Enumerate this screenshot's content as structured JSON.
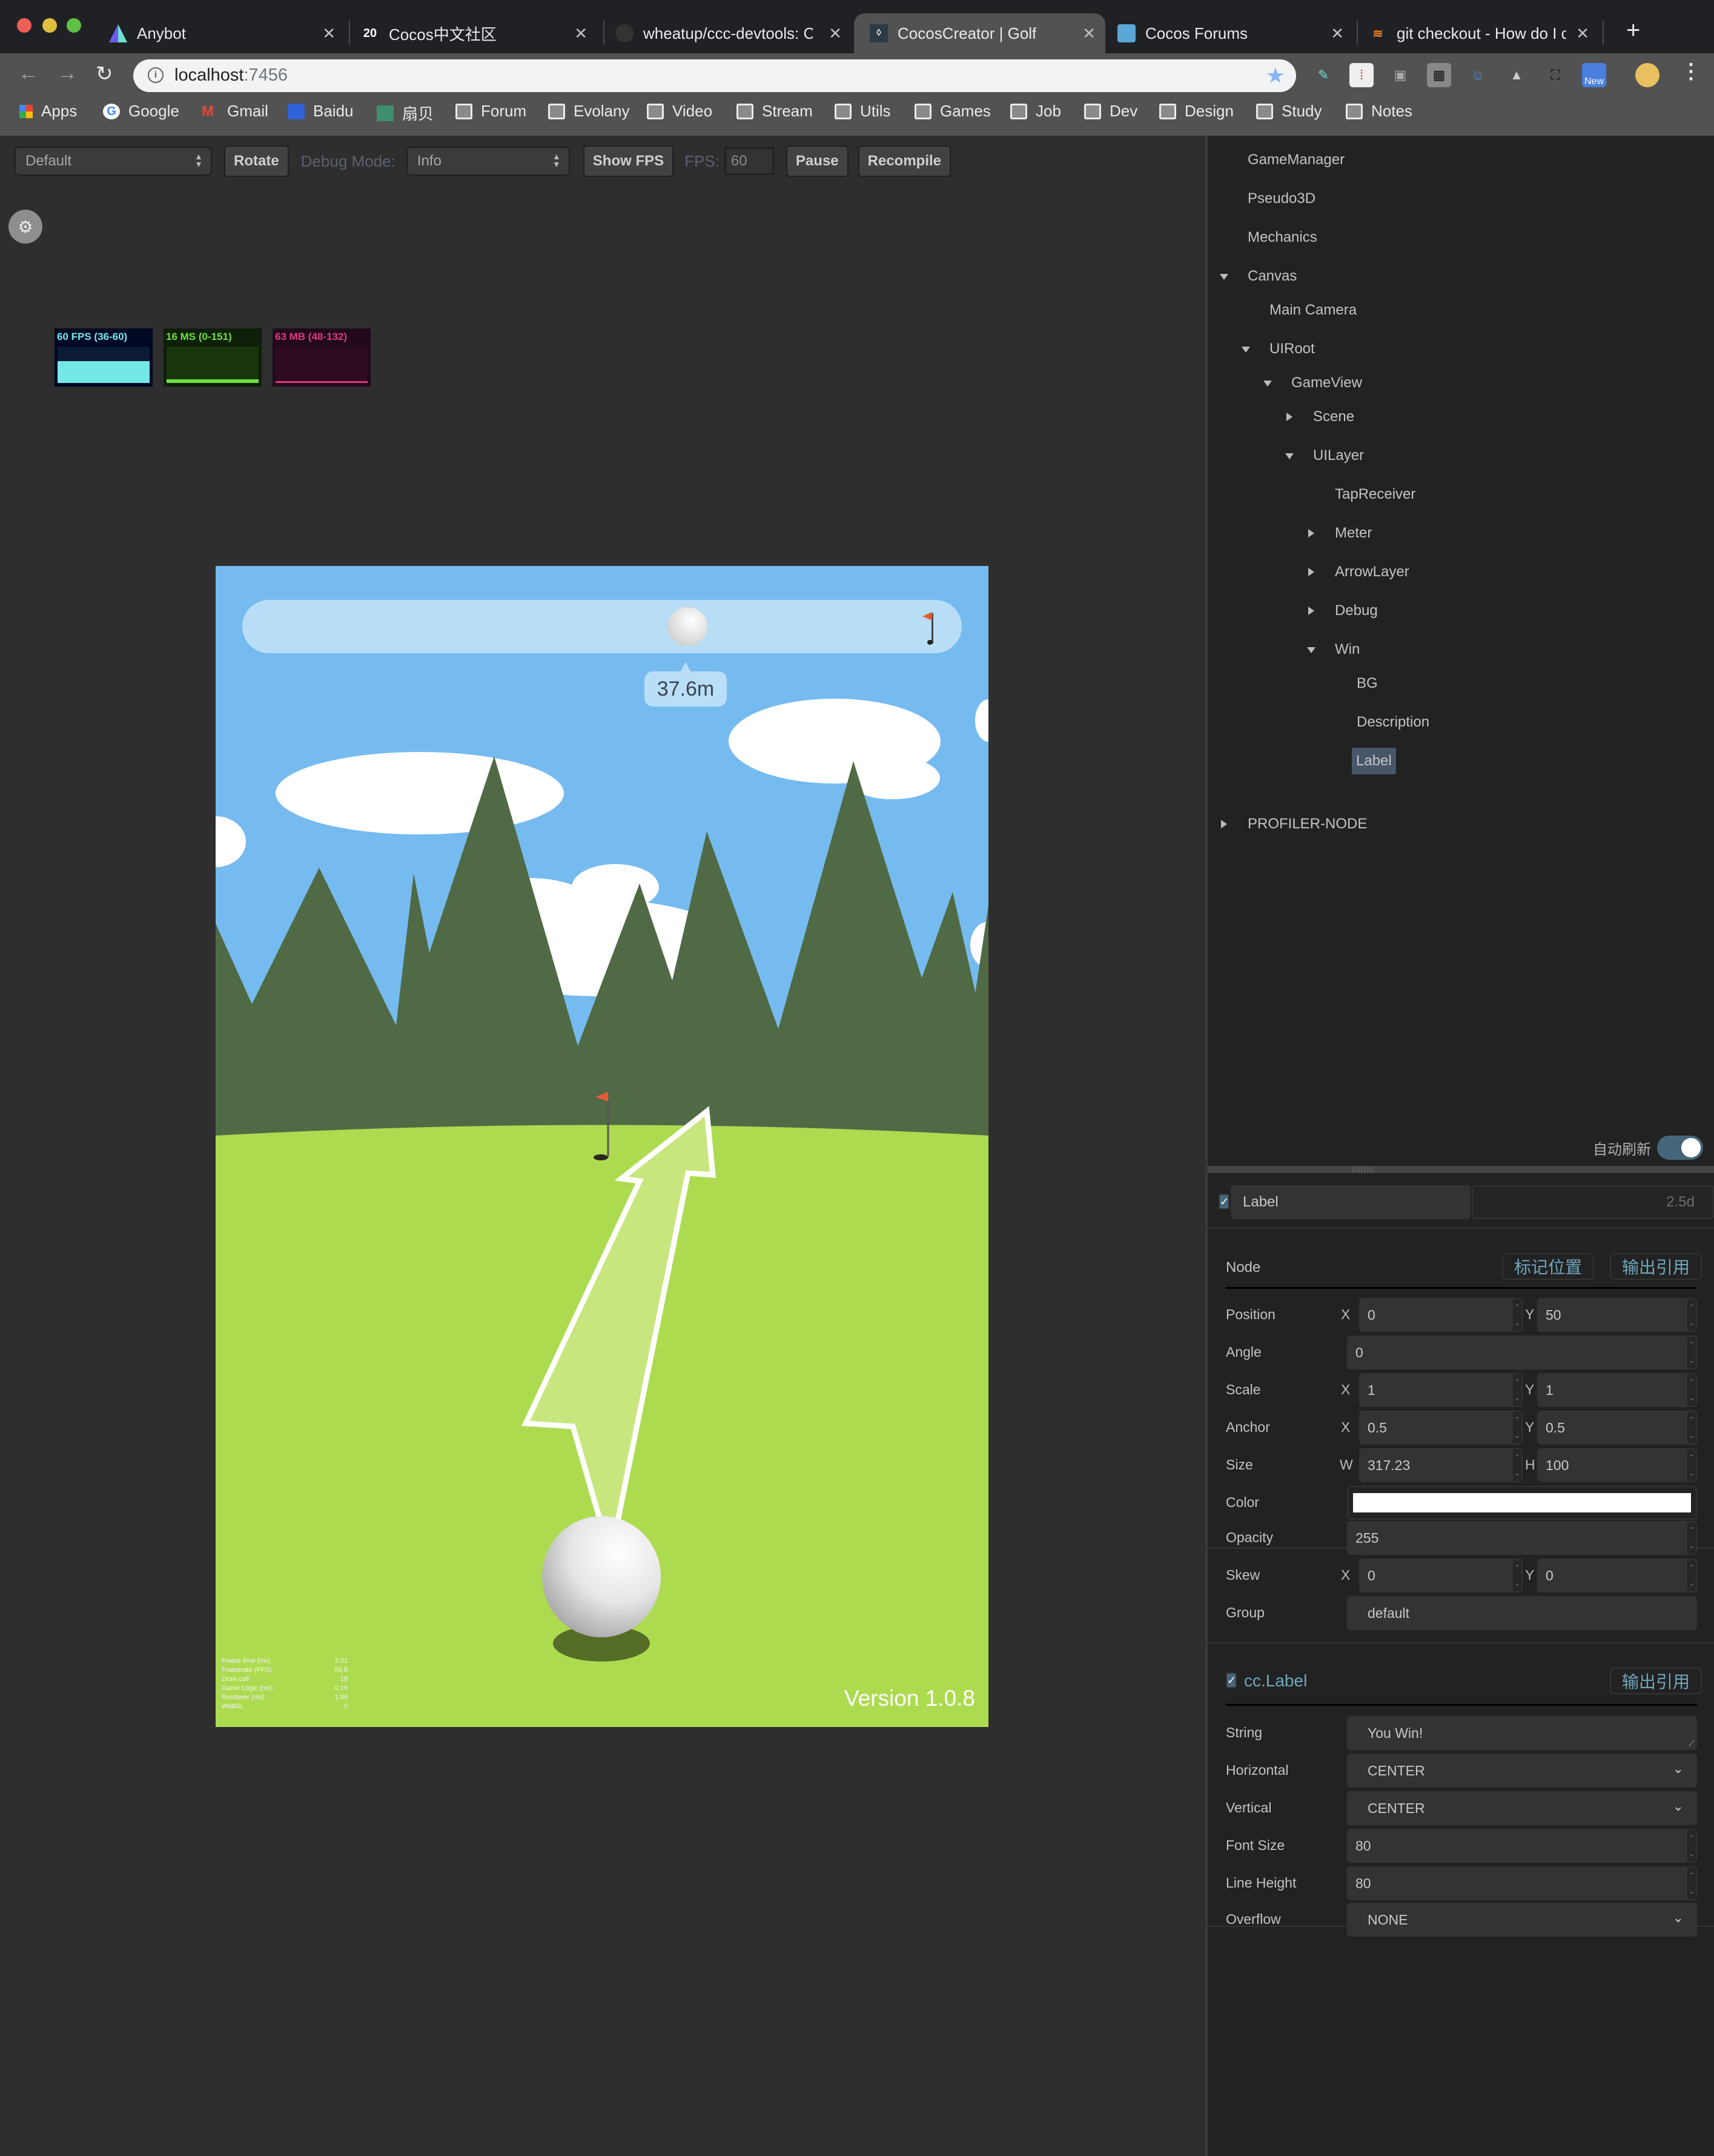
{
  "browser": {
    "tabs": [
      {
        "title": "Anybot",
        "icon": "anybot-icon",
        "active": false
      },
      {
        "title": "Cocos中文社区",
        "icon": "discourse-20-icon",
        "active": false
      },
      {
        "title": "wheatup/ccc-devtools: C",
        "icon": "github-icon",
        "active": false
      },
      {
        "title": "CocosCreator | Golf",
        "icon": "cocoscreator-icon",
        "active": true
      },
      {
        "title": "Cocos Forums",
        "icon": "cocos-icon",
        "active": false
      },
      {
        "title": "git checkout - How do I c",
        "icon": "stackoverflow-icon",
        "active": false
      }
    ],
    "new_tab": "+",
    "url_host": "localhost",
    "url_port": ":7456",
    "extensions": [
      "eyedropper-icon",
      "dice-icon",
      "tv-icon",
      "qr-code-icon",
      "avatar-glasses-icon",
      "drive-icon",
      "fullscreen-icon",
      "new-badge-icon"
    ],
    "new_badge": "New",
    "bookmarks": [
      {
        "label": "Apps",
        "icon": "apps-grid-icon"
      },
      {
        "label": "Google",
        "icon": "google-icon"
      },
      {
        "label": "Gmail",
        "icon": "gmail-icon"
      },
      {
        "label": "Baidu",
        "icon": "baidu-icon"
      },
      {
        "label": "扇贝",
        "icon": "shanbay-icon"
      },
      {
        "label": "Forum",
        "icon": "folder-icon"
      },
      {
        "label": "Evolany",
        "icon": "folder-icon"
      },
      {
        "label": "Video",
        "icon": "folder-icon"
      },
      {
        "label": "Stream",
        "icon": "folder-icon"
      },
      {
        "label": "Utils",
        "icon": "folder-icon"
      },
      {
        "label": "Games",
        "icon": "folder-icon"
      },
      {
        "label": "Job",
        "icon": "folder-icon"
      },
      {
        "label": "Dev",
        "icon": "folder-icon"
      },
      {
        "label": "Design",
        "icon": "folder-icon"
      },
      {
        "label": "Study",
        "icon": "folder-icon"
      },
      {
        "label": "Notes",
        "icon": "folder-icon"
      }
    ]
  },
  "preview_toolbar": {
    "device_select": "Default",
    "rotate": "Rotate",
    "debug_mode_label": "Debug Mode:",
    "debug_mode_value": "Info",
    "show_fps": "Show FPS",
    "fps_label": "FPS:",
    "fps_value": "60",
    "pause": "Pause",
    "recompile": "Recompile"
  },
  "profiler": [
    {
      "label": "60 FPS (36-60)",
      "color": "#74e8e8",
      "bg": "#000824",
      "graph_bg": "#0b1b35",
      "level": 0.6
    },
    {
      "label": "16 MS (0-151)",
      "color": "#6fe03f",
      "bg": "#0e1f0a",
      "graph_bg": "#18360e",
      "level": 0.1
    },
    {
      "label": "63 MB (48-132)",
      "color": "#de3a7d",
      "bg": "#21091a",
      "graph_bg": "#2e0b1f",
      "level": 0.05
    }
  ],
  "game": {
    "distance": "37.6m",
    "version": "Version 1.0.8",
    "debug_stats": [
      {
        "key": "Frame time (ms)",
        "value": "2.01"
      },
      {
        "key": "Framerate (FPS)",
        "value": "59.8"
      },
      {
        "key": "Draw call",
        "value": "18"
      },
      {
        "key": "Game Logic (ms)",
        "value": "0.16"
      },
      {
        "key": "Renderer (ms)",
        "value": "1.86"
      },
      {
        "key": "WebGL",
        "value": "0"
      }
    ],
    "colors": {
      "sky": "#76bbf0",
      "trees": "#506a45",
      "grass": "#addb50",
      "flag": "#e85a35"
    }
  },
  "devtools": {
    "tree": [
      {
        "label": "GameManager",
        "depth": 0,
        "toggle": "none"
      },
      {
        "label": "Pseudo3D",
        "depth": 0,
        "toggle": "none"
      },
      {
        "label": "Mechanics",
        "depth": 0,
        "toggle": "none"
      },
      {
        "label": "Canvas",
        "depth": 0,
        "toggle": "expanded"
      },
      {
        "label": "Main Camera",
        "depth": 1,
        "toggle": "none"
      },
      {
        "label": "UIRoot",
        "depth": 1,
        "toggle": "expanded"
      },
      {
        "label": "GameView",
        "depth": 2,
        "toggle": "expanded"
      },
      {
        "label": "Scene",
        "depth": 3,
        "toggle": "collapsed"
      },
      {
        "label": "UILayer",
        "depth": 3,
        "toggle": "expanded"
      },
      {
        "label": "TapReceiver",
        "depth": 4,
        "toggle": "none"
      },
      {
        "label": "Meter",
        "depth": 4,
        "toggle": "collapsed"
      },
      {
        "label": "ArrowLayer",
        "depth": 4,
        "toggle": "collapsed"
      },
      {
        "label": "Debug",
        "depth": 4,
        "toggle": "collapsed"
      },
      {
        "label": "Win",
        "depth": 4,
        "toggle": "expanded"
      },
      {
        "label": "BG",
        "depth": 5,
        "toggle": "none"
      },
      {
        "label": "Description",
        "depth": 5,
        "toggle": "none"
      },
      {
        "label": "Label",
        "depth": 5,
        "toggle": "none",
        "selected": true
      },
      {
        "label": "PROFILER-NODE",
        "depth": 0,
        "toggle": "collapsed"
      }
    ],
    "auto_refresh_label": "自动刷新",
    "auto_refresh_on": true,
    "node_name": "Label",
    "node_tag": "2.5d",
    "node_active": true,
    "node_section": {
      "title": "Node",
      "mark_position": "标记位置",
      "export_ref": "输出引用",
      "position": {
        "label": "Position",
        "x": "0",
        "y": "50"
      },
      "angle": {
        "label": "Angle",
        "value": "0"
      },
      "scale": {
        "label": "Scale",
        "x": "1",
        "y": "1"
      },
      "anchor": {
        "label": "Anchor",
        "x": "0.5",
        "y": "0.5"
      },
      "size": {
        "label": "Size",
        "w": "317.23",
        "h": "100"
      },
      "color": {
        "label": "Color",
        "value": "#ffffff"
      },
      "opacity": {
        "label": "Opacity",
        "value": "255"
      },
      "skew": {
        "label": "Skew",
        "x": "0",
        "y": "0"
      },
      "group": {
        "label": "Group",
        "value": "default"
      }
    },
    "label_section": {
      "title": "cc.Label",
      "enabled": true,
      "export_ref": "输出引用",
      "string": {
        "label": "String",
        "value": "You Win!"
      },
      "horizontal": {
        "label": "Horizontal",
        "value": "CENTER"
      },
      "vertical": {
        "label": "Vertical",
        "value": "CENTER"
      },
      "font_size": {
        "label": "Font Size",
        "value": "80"
      },
      "line_height": {
        "label": "Line Height",
        "value": "80"
      },
      "overflow": {
        "label": "Overflow",
        "value": "NONE"
      }
    }
  }
}
